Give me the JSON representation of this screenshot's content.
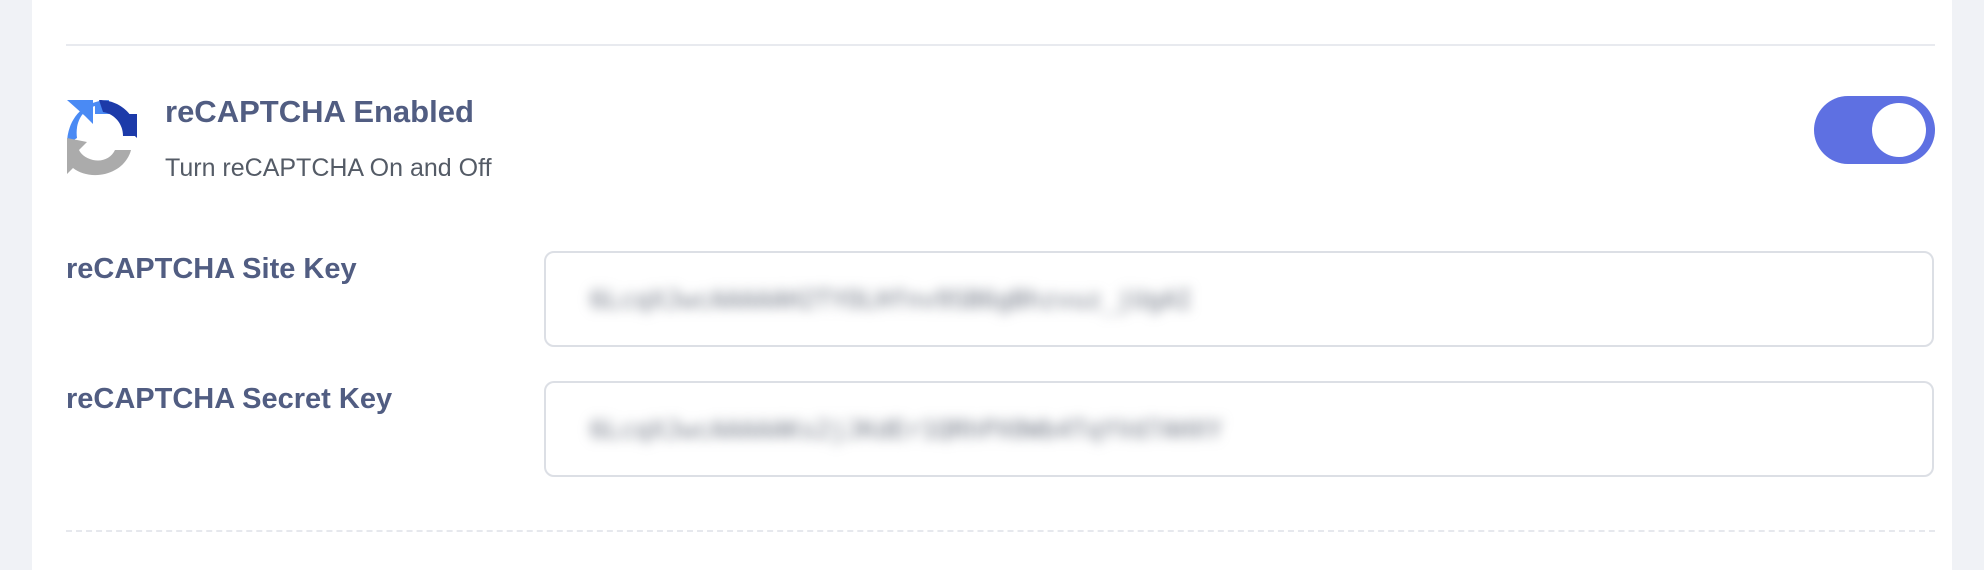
{
  "recaptcha": {
    "toggle_title": "reCAPTCHA Enabled",
    "toggle_description": "Turn reCAPTCHA On and Off",
    "toggle_state": "on",
    "logo_icon": "recaptcha-logo-icon",
    "colors": {
      "accent": "#5e70e2",
      "label": "#515d82",
      "logo_blue": "#4a8af4",
      "logo_dark_blue": "#1c3aa9",
      "logo_grey": "#ababab"
    }
  },
  "fields": {
    "site_key": {
      "label": "reCAPTCHA Site Key",
      "value": "6LcqXJwcAAAAAH2TYOLHfnv9SB6gBhzvuz_jUgAI"
    },
    "secret_key": {
      "label": "reCAPTCHA Secret Key",
      "value": "6LcqXJwcAAAAAKs2jJKdEr1QRhPX0Wb4TqYVd7AHXY"
    }
  }
}
